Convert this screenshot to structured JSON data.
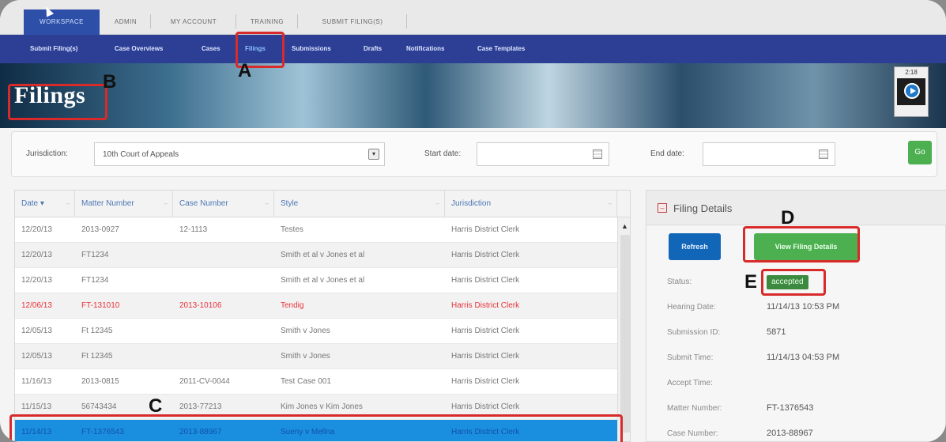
{
  "top_tabs": [
    {
      "label": "WORKSPACE",
      "active": true
    },
    {
      "label": "ADMIN",
      "active": false
    },
    {
      "label": "MY ACCOUNT",
      "active": false
    },
    {
      "label": "TRAINING",
      "active": false
    },
    {
      "label": "SUBMIT FILING(S)",
      "active": false
    }
  ],
  "sub_nav": [
    {
      "label": "Submit Filing(s)"
    },
    {
      "label": "Case Overviews"
    },
    {
      "label": "Cases"
    },
    {
      "label": "Filings",
      "active": true
    },
    {
      "label": "Submissions"
    },
    {
      "label": "Drafts"
    },
    {
      "label": "Notifications"
    },
    {
      "label": "Case Templates"
    }
  ],
  "banner": {
    "title": "Filings",
    "video_time": "2:18",
    "video_icon": "play-icon"
  },
  "filters": {
    "jurisdiction_label": "Jurisdiction:",
    "jurisdiction_value": "10th Court of Appeals",
    "start_date_label": "Start date:",
    "start_date_value": "",
    "end_date_label": "End date:",
    "end_date_value": "",
    "go_label": "Go"
  },
  "grid": {
    "columns": [
      "Date",
      "Matter Number",
      "Case Number",
      "Style",
      "Jurisdiction"
    ],
    "rows": [
      {
        "date": "12/20/13",
        "matter": "2013-0927",
        "case": "12-1113",
        "style": "Testes",
        "jurisdiction": "Harris District Clerk",
        "highlight": ""
      },
      {
        "date": "12/20/13",
        "matter": "FT1234",
        "case": "",
        "style": "Smith et al v Jones et al",
        "jurisdiction": "Harris District Clerk",
        "highlight": ""
      },
      {
        "date": "12/20/13",
        "matter": "FT1234",
        "case": "",
        "style": "Smith et al v Jones et al",
        "jurisdiction": "Harris District Clerk",
        "highlight": ""
      },
      {
        "date": "12/06/13",
        "matter": "FT-131010",
        "case": "2013-10106",
        "style": "Tendig",
        "jurisdiction": "Harris District Clerk",
        "highlight": "red"
      },
      {
        "date": "12/05/13",
        "matter": "Ft 12345",
        "case": "",
        "style": "Smith v Jones",
        "jurisdiction": "Harris District Clerk",
        "highlight": ""
      },
      {
        "date": "12/05/13",
        "matter": "Ft 12345",
        "case": "",
        "style": "Smith v Jones",
        "jurisdiction": "Harris District Clerk",
        "highlight": ""
      },
      {
        "date": "11/16/13",
        "matter": "2013-0815",
        "case": "2011-CV-0044",
        "style": "Test Case 001",
        "jurisdiction": "Harris District Clerk",
        "highlight": ""
      },
      {
        "date": "11/15/13",
        "matter": "56743434",
        "case": "2013-77213",
        "style": "Kim Jones v Kim Jones",
        "jurisdiction": "Harris District Clerk",
        "highlight": ""
      },
      {
        "date": "11/14/13",
        "matter": "FT-1376543",
        "case": "2013-88967",
        "style": "Sueny v Mellna",
        "jurisdiction": "Harris District Clerk",
        "highlight": "selected"
      }
    ]
  },
  "details": {
    "title": "Filing Details",
    "refresh_label": "Refresh",
    "view_label": "View Filing Details",
    "fields": [
      {
        "label": "Status:",
        "value": "accepted",
        "badge": true
      },
      {
        "label": "Hearing Date:",
        "value": "11/14/13 10:53 PM"
      },
      {
        "label": "Submission ID:",
        "value": "5871"
      },
      {
        "label": "Submit Time:",
        "value": "11/14/13 04:53 PM"
      },
      {
        "label": "Accept Time:",
        "value": ""
      },
      {
        "label": "Matter Number:",
        "value": "FT-1376543"
      },
      {
        "label": "Case Number:",
        "value": "2013-88967"
      }
    ]
  },
  "annotations": [
    "A",
    "B",
    "C",
    "D",
    "E"
  ],
  "colors": {
    "tab_active": "#2e4fa8",
    "subnav": "#2c3f95",
    "accent_red": "#d82a2a",
    "go_green": "#4caf50",
    "refresh_blue": "#1266b8",
    "selected_row": "#1a8fe0",
    "status_green": "#3b8a3f"
  }
}
